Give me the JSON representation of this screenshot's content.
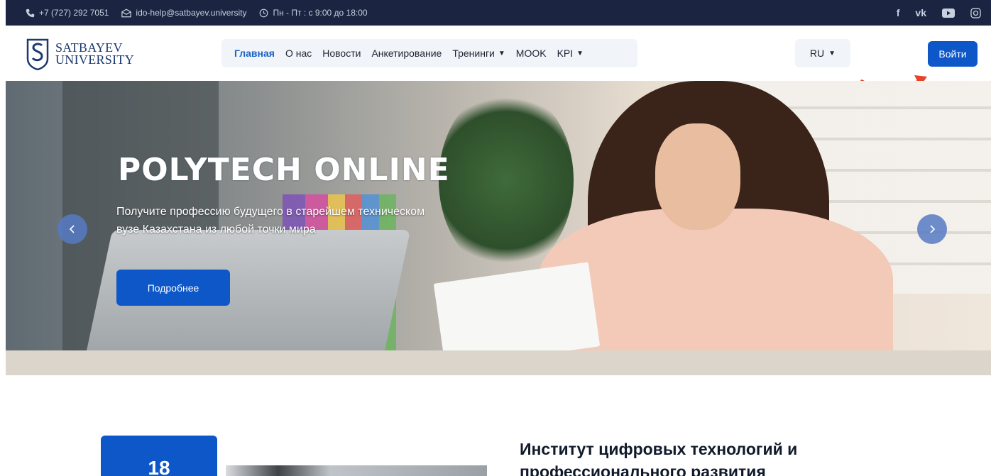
{
  "topbar": {
    "phone": "+7 (727) 292 7051",
    "email": "ido-help@satbayev.university",
    "hours": "Пн - Пт : с 9:00 до 18:00",
    "social": [
      "facebook-icon",
      "vk-icon",
      "youtube-icon",
      "instagram-icon"
    ]
  },
  "logo": {
    "line1": "SATBAYEV",
    "line2": "UNIVERSITY"
  },
  "nav": {
    "items": [
      {
        "label": "Главная",
        "active": true
      },
      {
        "label": "О нас"
      },
      {
        "label": "Новости"
      },
      {
        "label": "Анкетирование"
      },
      {
        "label": "Тренинги",
        "dropdown": true
      },
      {
        "label": "MOOK"
      },
      {
        "label": "KPI",
        "dropdown": true
      }
    ]
  },
  "lang": {
    "value": "RU"
  },
  "login": {
    "label": "Войти"
  },
  "hero": {
    "title": "POLYTECH ONLINE",
    "subtitle_line1": "Получите профессию будущего в старейшем техническом",
    "subtitle_line2": "вузе Казахстана из любой точки мира",
    "cta": "Подробнее"
  },
  "stat": {
    "value": "18"
  },
  "section": {
    "title_line1": "Институт цифровых технологий и",
    "title_line2": "профессионального развития"
  },
  "colors": {
    "brand_blue": "#0d57c8",
    "topbar_bg": "#1b2541",
    "arrow": "#e8432a"
  }
}
